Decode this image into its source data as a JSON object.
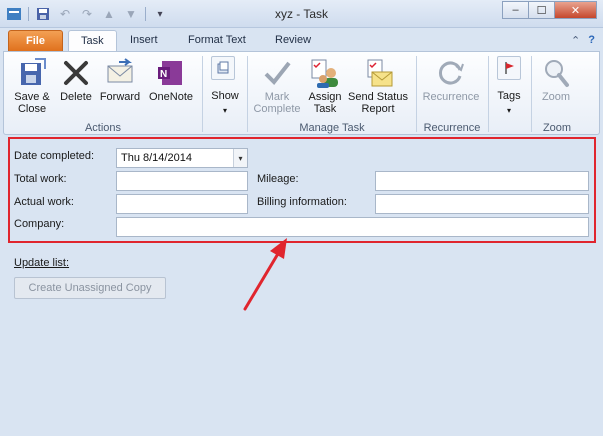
{
  "window": {
    "title": "xyz  -  Task"
  },
  "tabs": [
    {
      "label": "File"
    },
    {
      "label": "Task"
    },
    {
      "label": "Insert"
    },
    {
      "label": "Format Text"
    },
    {
      "label": "Review"
    }
  ],
  "ribbon": {
    "actions": {
      "save_close_1": "Save &",
      "save_close_2": "Close",
      "delete": "Delete",
      "forward": "Forward",
      "onenote": "OneNote",
      "group_label": "Actions"
    },
    "show": {
      "label": "Show"
    },
    "manage_task": {
      "mark_complete_1": "Mark",
      "mark_complete_2": "Complete",
      "assign_task_1": "Assign",
      "assign_task_2": "Task",
      "send_status_1": "Send Status",
      "send_status_2": "Report",
      "group_label": "Manage Task"
    },
    "recurrence": {
      "label": "Recurrence",
      "group_label": "Recurrence"
    },
    "tags": {
      "label": "Tags"
    },
    "zoom": {
      "label": "Zoom",
      "group_label": "Zoom"
    }
  },
  "form": {
    "date_completed_label": "Date completed:",
    "date_completed_value": "Thu 8/14/2014",
    "total_work_label": "Total work:",
    "total_work_value": "",
    "mileage_label": "Mileage:",
    "mileage_value": "",
    "actual_work_label": "Actual work:",
    "actual_work_value": "",
    "billing_label": "Billing information:",
    "billing_value": "",
    "company_label": "Company:",
    "company_value": "",
    "update_list_label": "Update list:",
    "create_unassigned_label": "Create Unassigned Copy"
  },
  "colors": {
    "highlight": "#e0252e",
    "file_tab": "#e8791f"
  }
}
